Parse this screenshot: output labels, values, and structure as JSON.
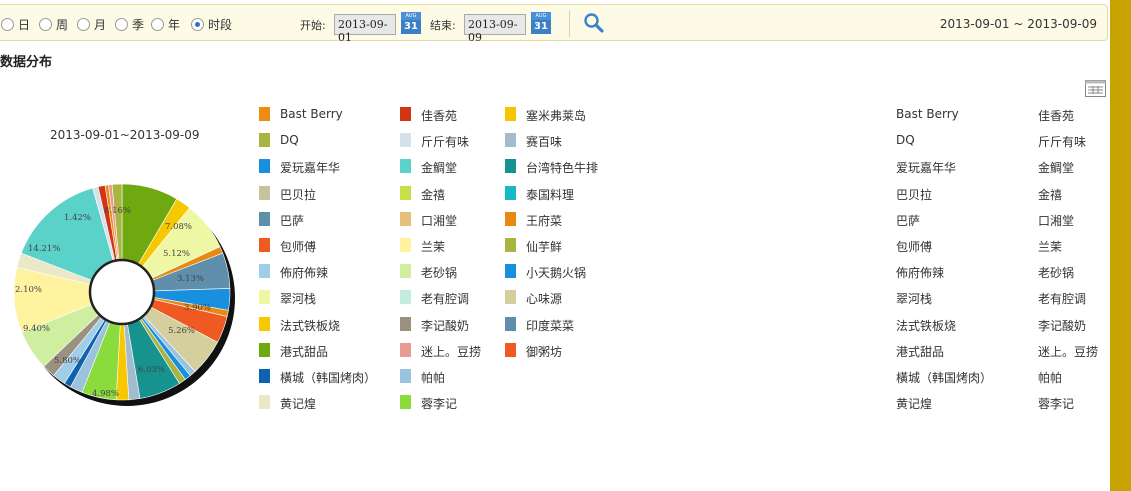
{
  "toolbar": {
    "period_options": [
      {
        "label": "日",
        "checked": false
      },
      {
        "label": "周",
        "checked": false
      },
      {
        "label": "月",
        "checked": false
      },
      {
        "label": "季",
        "checked": false
      },
      {
        "label": "年",
        "checked": false
      },
      {
        "label": "时段",
        "checked": true
      }
    ],
    "start_label": "开始:",
    "start_value": "2013-09-01",
    "end_label": "结束:",
    "end_value": "2013-09-09",
    "calendar_top": "AUG",
    "calendar_day": "31",
    "date_range_text": "2013-09-01 ~ 2013-09-09"
  },
  "section_title": "数据分布",
  "chart_data": {
    "type": "pie",
    "title": "2013-09-01~2013-09-09",
    "legend_position": "right",
    "slices": [
      {
        "label": "港式甜品",
        "value": 8.16,
        "color": "#6fa80f"
      },
      {
        "label": "法式铁板烧",
        "value": 2.2,
        "color": "#f6c800"
      },
      {
        "label": "翠河栈",
        "value": 7.08,
        "color": "#eef7a4"
      },
      {
        "label": "王府菜",
        "value": 1.0,
        "color": "#e88a12"
      },
      {
        "label": "巴萨",
        "value": 5.12,
        "color": "#5f8fab"
      },
      {
        "label": "小天鹅火锅",
        "value": 3.13,
        "color": "#1990dd"
      },
      {
        "label": "王府菜",
        "value": 0.9,
        "color": "#e88a12"
      },
      {
        "label": "包师傅",
        "value": 3.9,
        "color": "#ee5a22"
      },
      {
        "label": "心味源",
        "value": 5.26,
        "color": "#d4cf9c"
      },
      {
        "label": "帕帕",
        "value": 0.9,
        "color": "#9bc2df"
      },
      {
        "label": "小天鹅火锅",
        "value": 0.9,
        "color": "#1990dd"
      },
      {
        "label": "仙芋鲜",
        "value": 1.0,
        "color": "#a8b542"
      },
      {
        "label": "台湾特色牛排",
        "value": 6.03,
        "color": "#16938f"
      },
      {
        "label": "赛百味",
        "value": 1.6,
        "color": "#a2bccd"
      },
      {
        "label": "法式铁板烧",
        "value": 1.8,
        "color": "#f6c800"
      },
      {
        "label": "蓉李记",
        "value": 4.98,
        "color": "#8adc3c"
      },
      {
        "label": "帕帕",
        "value": 1.8,
        "color": "#9bc2df"
      },
      {
        "label": "橫城（韩国烤肉）",
        "value": 1.0,
        "color": "#0e62b0"
      },
      {
        "label": "佈府佈辣",
        "value": 1.9,
        "color": "#a0cde8"
      },
      {
        "label": "李记酸奶",
        "value": 1.9,
        "color": "#9b9181"
      },
      {
        "label": "老砂锅",
        "value": 5.8,
        "color": "#cfee9f"
      },
      {
        "label": "兰茉",
        "value": 9.4,
        "color": "#fff3a0"
      },
      {
        "label": "黄记煌",
        "value": 2.1,
        "color": "#ebe8c8"
      },
      {
        "label": "金鲷堂",
        "value": 14.21,
        "color": "#5ad2ca"
      },
      {
        "label": "斤斤有味",
        "value": 0.8,
        "color": "#d5e2ec"
      },
      {
        "label": "佳香苑",
        "value": 1.0,
        "color": "#d13614"
      },
      {
        "label": "Bast Berry",
        "value": 0.5,
        "color": "#ee8c12"
      },
      {
        "label": "迷上。豆捞",
        "value": 0.5,
        "color": "#e89a92"
      },
      {
        "label": "DQ",
        "value": 1.42,
        "color": "#a8b542"
      }
    ],
    "data_labels": [
      {
        "text": "8.16%"
      },
      {
        "text": "7.08%"
      },
      {
        "text": "5.12%"
      },
      {
        "text": "3.13%"
      },
      {
        "text": "3.90%"
      },
      {
        "text": "5.26%"
      },
      {
        "text": "6.03%"
      },
      {
        "text": "4.98%"
      },
      {
        "text": "5.80%"
      },
      {
        "text": "9.40%"
      },
      {
        "text": "2.10%"
      },
      {
        "text": "14.21%"
      },
      {
        "text": "1.42%"
      }
    ],
    "legend": [
      {
        "label": "Bast Berry",
        "color": "#ee8c12"
      },
      {
        "label": "DQ",
        "color": "#a8b542"
      },
      {
        "label": "爱玩嘉年华",
        "color": "#1a8fdf"
      },
      {
        "label": "巴贝拉",
        "color": "#c8c29a"
      },
      {
        "label": "巴萨",
        "color": "#5f8fab"
      },
      {
        "label": "包师傅",
        "color": "#ee5a22"
      },
      {
        "label": "佈府佈辣",
        "color": "#a0cde8"
      },
      {
        "label": "翠河栈",
        "color": "#eef7a4"
      },
      {
        "label": "法式铁板烧",
        "color": "#f6c800"
      },
      {
        "label": "港式甜品",
        "color": "#6fa80f"
      },
      {
        "label": "橫城（韩国烤肉）",
        "color": "#0e62b0"
      },
      {
        "label": "黄记煌",
        "color": "#ebe8c8"
      },
      {
        "label": "佳香苑",
        "color": "#d13614"
      },
      {
        "label": "斤斤有味",
        "color": "#d5e2ec"
      },
      {
        "label": "金鲷堂",
        "color": "#5ad2ca"
      },
      {
        "label": "金禧",
        "color": "#c4e04a"
      },
      {
        "label": "口湘堂",
        "color": "#e6c07a"
      },
      {
        "label": "兰茉",
        "color": "#fff3a0"
      },
      {
        "label": "老砂锅",
        "color": "#cfee9f"
      },
      {
        "label": "老有腔调",
        "color": "#c3ece0"
      },
      {
        "label": "李记酸奶",
        "color": "#9b9181"
      },
      {
        "label": "迷上。豆捞",
        "color": "#e89a92"
      },
      {
        "label": "帕帕",
        "color": "#9bc2df"
      },
      {
        "label": "蓉李记",
        "color": "#8adc3c"
      },
      {
        "label": "塞米弗莱岛",
        "color": "#f6c400"
      },
      {
        "label": "赛百味",
        "color": "#a2bccd"
      },
      {
        "label": "台湾特色牛排",
        "color": "#16938f"
      },
      {
        "label": "泰国料理",
        "color": "#19b8c8"
      },
      {
        "label": "王府菜",
        "color": "#e88a12"
      },
      {
        "label": "仙芋鲜",
        "color": "#a8b542"
      },
      {
        "label": "小天鹅火锅",
        "color": "#1990dd"
      },
      {
        "label": "心味源",
        "color": "#d4cf9c"
      },
      {
        "label": "印度菜菜",
        "color": "#5f8fab"
      },
      {
        "label": "御粥坊",
        "color": "#ee5a22"
      }
    ]
  },
  "right_table": {
    "rows": [
      [
        "Bast Berry",
        "佳香苑"
      ],
      [
        "DQ",
        "斤斤有味"
      ],
      [
        "爱玩嘉年华",
        "金鲷堂"
      ],
      [
        "巴贝拉",
        "金禧"
      ],
      [
        "巴萨",
        "口湘堂"
      ],
      [
        "包师傅",
        "兰茉"
      ],
      [
        "佈府佈辣",
        "老砂锅"
      ],
      [
        "翠河栈",
        "老有腔调"
      ],
      [
        "法式铁板烧",
        "李记酸奶"
      ],
      [
        "港式甜品",
        "迷上。豆捞"
      ],
      [
        "橫城（韩国烤肉）",
        "帕帕"
      ],
      [
        "黄记煌",
        "蓉李记"
      ]
    ]
  }
}
